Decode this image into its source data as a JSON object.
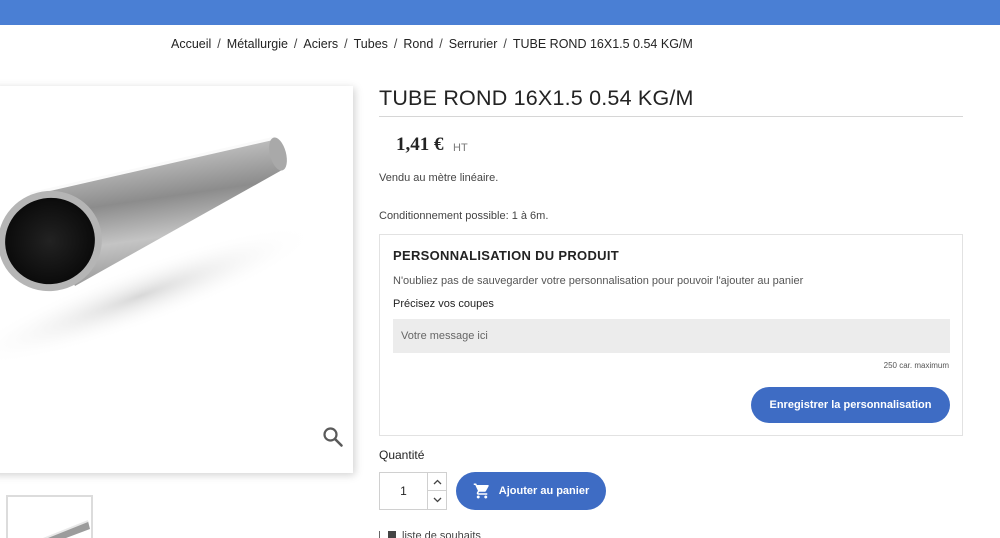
{
  "header": {
    "bar_color": "#4a7fd4"
  },
  "breadcrumb": {
    "items": [
      "Accueil",
      "Métallurgie",
      "Aciers",
      "Tubes",
      "Rond",
      "Serrurier",
      "TUBE ROND 16X1.5 0.54 KG/M"
    ],
    "separator": "/"
  },
  "product": {
    "title": "TUBE ROND 16X1.5 0.54 KG/M",
    "price": "1,41 €",
    "price_suffix": "HT",
    "description_line1": "Vendu au mètre linéaire.",
    "description_line2": "Conditionnement possible: 1 à 6m.",
    "image_icon": "zoom-icon"
  },
  "customization": {
    "title": "PERSONNALISATION DU PRODUIT",
    "note": "N'oubliez pas de sauvegarder votre personnalisation pour pouvoir l'ajouter au panier",
    "field_label": "Précisez vos coupes",
    "field_placeholder": "Votre message ici",
    "char_limit": "250 car. maximum",
    "save_label": "Enregistrer la personnalisation"
  },
  "purchase": {
    "quantity_label": "Quantité",
    "quantity_value": "1",
    "add_to_cart_label": "Ajouter au panier",
    "cart_icon": "cart-icon",
    "wishlist_label": "liste de souhaits"
  },
  "colors": {
    "accent": "#3e6cc4",
    "input_bg": "#ececec"
  }
}
